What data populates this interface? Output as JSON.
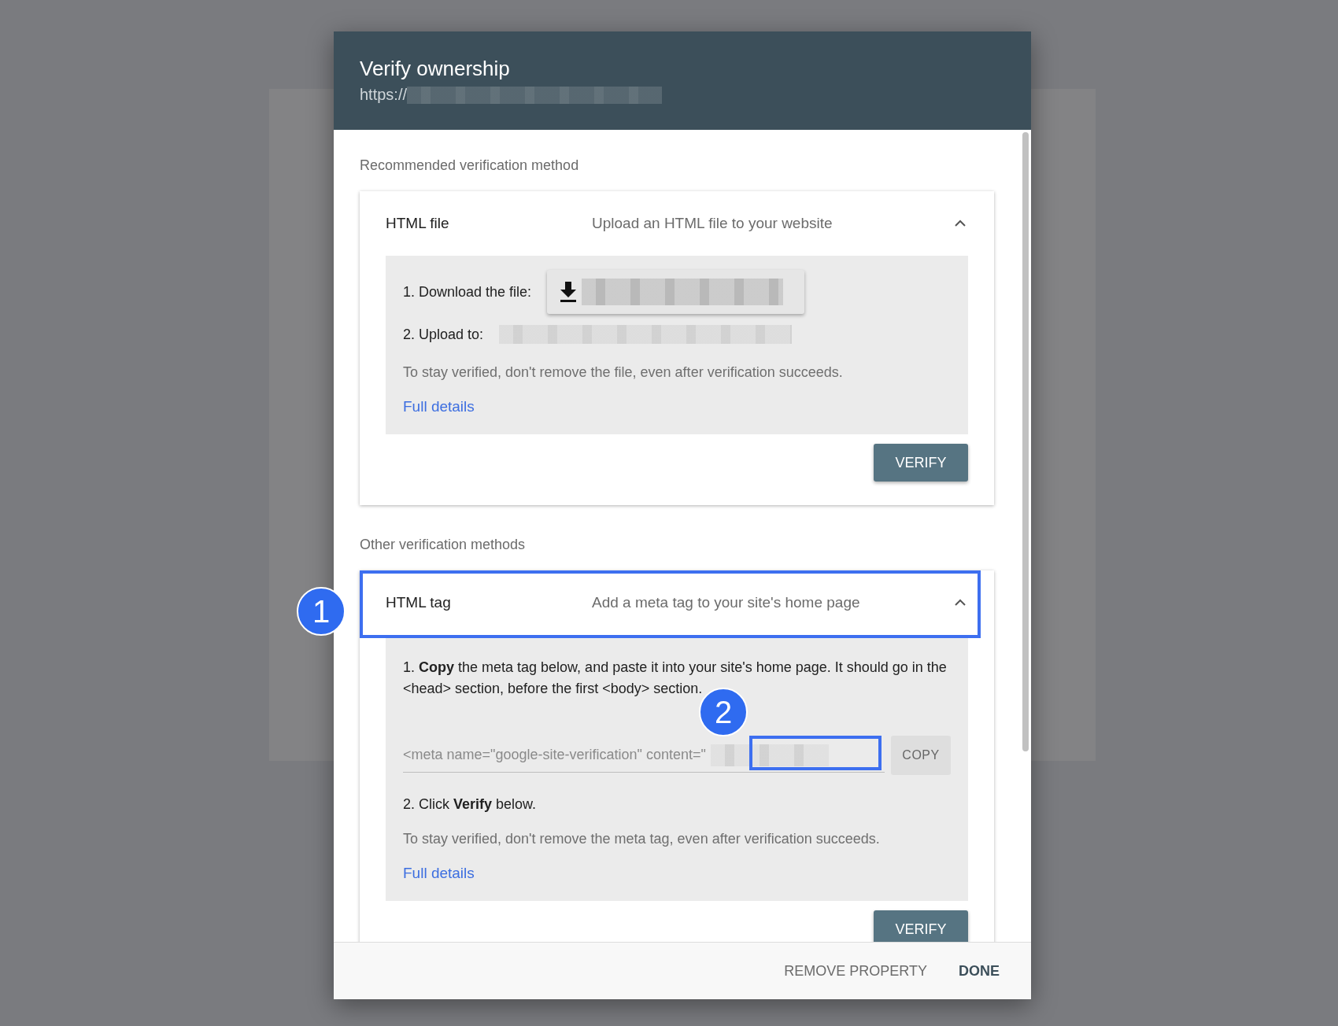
{
  "dialog": {
    "title": "Verify ownership",
    "url_prefix": "https://"
  },
  "sections": [
    {
      "heading": "Recommended verification method",
      "methods": [
        {
          "name": "HTML file",
          "description": "Upload an HTML file to your website",
          "expanded": true,
          "steps": [
            {
              "kind": "download",
              "text": "1. Download the file:"
            },
            {
              "kind": "upload",
              "text": "2. Upload to:"
            },
            {
              "kind": "note",
              "text": "To stay verified, don't remove the file, even after verification succeeds."
            }
          ],
          "link": "Full details",
          "button": "VERIFY"
        }
      ]
    },
    {
      "heading": "Other verification methods",
      "methods": [
        {
          "name": "HTML tag",
          "description": "Add a meta tag to your site's home page",
          "expanded": true,
          "callout": "1",
          "steps": [
            {
              "kind": "paragraph",
              "text": "1. **Copy** the meta tag below, and paste it into your site's home page. It should go in the <head> section, before the first <body> section."
            },
            {
              "kind": "code",
              "value": "<meta name=\"google-site-verification\" content=\"",
              "button": "COPY",
              "callout": "2"
            },
            {
              "kind": "paragraph",
              "text": "2. Click **Verify** below."
            },
            {
              "kind": "note",
              "text": "To stay verified, don't remove the meta tag, even after verification succeeds."
            }
          ],
          "link": "Full details",
          "button": "VERIFY"
        }
      ]
    }
  ],
  "footer": {
    "buttons": [
      "REMOVE PROPERTY",
      "DONE"
    ]
  }
}
